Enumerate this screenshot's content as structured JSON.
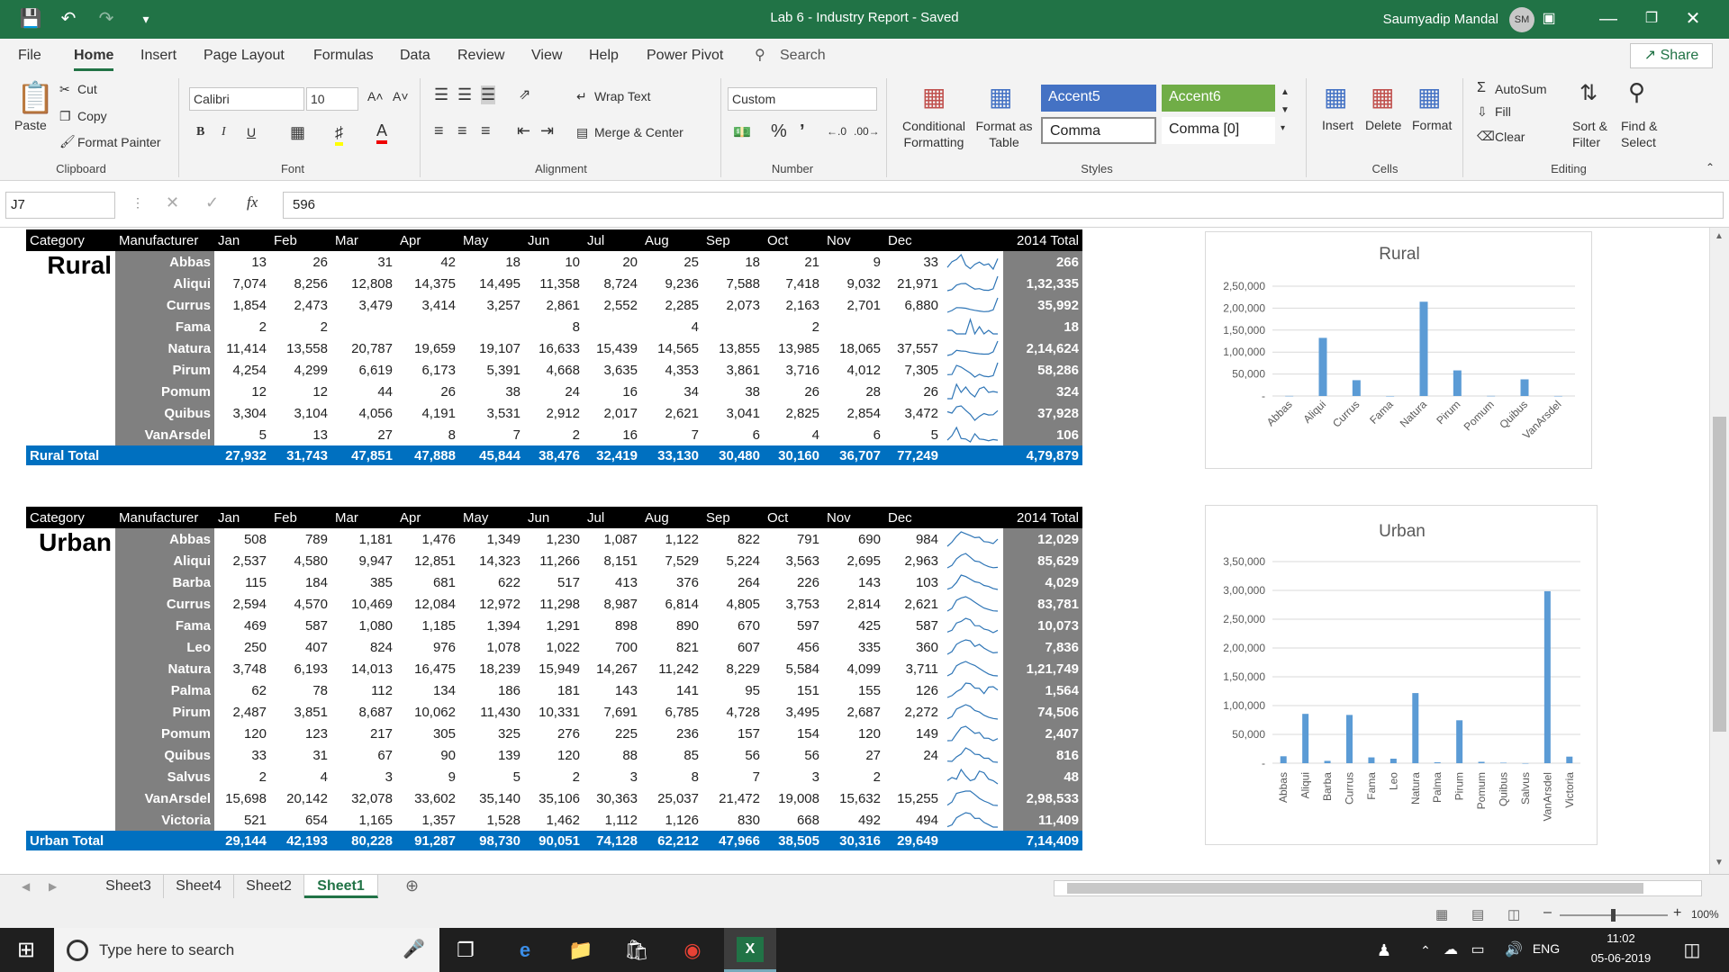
{
  "window": {
    "title": "Lab 6 - Industry Report  -  Saved",
    "user": "Saumyadip Mandal",
    "initials": "SM"
  },
  "menu": {
    "tabs": [
      "File",
      "Home",
      "Insert",
      "Page Layout",
      "Formulas",
      "Data",
      "Review",
      "View",
      "Help",
      "Power Pivot"
    ],
    "search": "Search",
    "share": "Share"
  },
  "ribbon": {
    "clipboard": {
      "paste": "Paste",
      "cut": "Cut",
      "copy": "Copy",
      "format_painter": "Format Painter",
      "label": "Clipboard"
    },
    "font": {
      "name": "Calibri",
      "size": "10",
      "label": "Font",
      "bold": "B",
      "italic": "I",
      "underline": "U"
    },
    "alignment": {
      "wrap": "Wrap Text",
      "merge": "Merge & Center",
      "label": "Alignment"
    },
    "number": {
      "format": "Custom",
      "label": "Number",
      "percent": "%"
    },
    "styles": {
      "conditional": "Conditional Formatting",
      "format_table": "Format as Table",
      "accent5": "Accent5",
      "accent6": "Accent6",
      "comma": "Comma",
      "comma0": "Comma [0]",
      "label": "Styles"
    },
    "cells": {
      "insert": "Insert",
      "delete": "Delete",
      "format": "Format",
      "label": "Cells"
    },
    "editing": {
      "autosum": "AutoSum",
      "fill": "Fill",
      "clear": "Clear",
      "sort": "Sort & Filter",
      "find": "Find & Select",
      "label": "Editing"
    }
  },
  "formula_bar": {
    "cell": "J7",
    "value": "596",
    "fx": "fx"
  },
  "headers": {
    "category": "Category",
    "manufacturer": "Manufacturer",
    "months": [
      "Jan",
      "Feb",
      "Mar",
      "Apr",
      "May",
      "Jun",
      "Jul",
      "Aug",
      "Sep",
      "Oct",
      "Nov",
      "Dec"
    ],
    "total": "2014 Total"
  },
  "rural": {
    "category": "Rural",
    "rows": [
      {
        "name": "Abbas",
        "m": [
          "13",
          "26",
          "31",
          "42",
          "18",
          "10",
          "20",
          "25",
          "18",
          "21",
          "9",
          "33"
        ],
        "total": "266",
        "spark": [
          13,
          26,
          31,
          42,
          18,
          10,
          20,
          25,
          18,
          21,
          9,
          33
        ]
      },
      {
        "name": "Aliqui",
        "m": [
          "7,074",
          "8,256",
          "12,808",
          "14,375",
          "14,495",
          "11,358",
          "8,724",
          "9,236",
          "7,588",
          "7,418",
          "9,032",
          "21,971"
        ],
        "total": "1,32,335",
        "spark": [
          7074,
          8256,
          12808,
          14375,
          14495,
          11358,
          8724,
          9236,
          7588,
          7418,
          9032,
          21971
        ]
      },
      {
        "name": "Currus",
        "m": [
          "1,854",
          "2,473",
          "3,479",
          "3,414",
          "3,257",
          "2,861",
          "2,552",
          "2,285",
          "2,073",
          "2,163",
          "2,701",
          "6,880"
        ],
        "total": "35,992",
        "spark": [
          1854,
          2473,
          3479,
          3414,
          3257,
          2861,
          2552,
          2285,
          2073,
          2163,
          2701,
          6880
        ]
      },
      {
        "name": "Fama",
        "m": [
          "2",
          "2",
          "",
          "",
          "",
          "8",
          "",
          "4",
          "",
          "2",
          "",
          ""
        ],
        "total": "18",
        "spark": [
          2,
          2,
          0,
          0,
          0,
          8,
          0,
          4,
          0,
          2,
          0,
          0
        ]
      },
      {
        "name": "Natura",
        "m": [
          "11,414",
          "13,558",
          "20,787",
          "19,659",
          "19,107",
          "16,633",
          "15,439",
          "14,565",
          "13,855",
          "13,985",
          "18,065",
          "37,557"
        ],
        "total": "2,14,624",
        "spark": [
          11414,
          13558,
          20787,
          19659,
          19107,
          16633,
          15439,
          14565,
          13855,
          13985,
          18065,
          37557
        ]
      },
      {
        "name": "Pirum",
        "m": [
          "4,254",
          "4,299",
          "6,619",
          "6,173",
          "5,391",
          "4,668",
          "3,635",
          "4,353",
          "3,861",
          "3,716",
          "4,012",
          "7,305"
        ],
        "total": "58,286",
        "spark": [
          4254,
          4299,
          6619,
          6173,
          5391,
          4668,
          3635,
          4353,
          3861,
          3716,
          4012,
          7305
        ]
      },
      {
        "name": "Pomum",
        "m": [
          "12",
          "12",
          "44",
          "26",
          "38",
          "24",
          "16",
          "34",
          "38",
          "26",
          "28",
          "26"
        ],
        "total": "324",
        "spark": [
          12,
          12,
          44,
          26,
          38,
          24,
          16,
          34,
          38,
          26,
          28,
          26
        ]
      },
      {
        "name": "Quibus",
        "m": [
          "3,304",
          "3,104",
          "4,056",
          "4,191",
          "3,531",
          "2,912",
          "2,017",
          "2,621",
          "3,041",
          "2,825",
          "2,854",
          "3,472"
        ],
        "total": "37,928",
        "spark": [
          3304,
          3104,
          4056,
          4191,
          3531,
          2912,
          2017,
          2621,
          3041,
          2825,
          2854,
          3472
        ]
      },
      {
        "name": "VanArsdel",
        "m": [
          "5",
          "13",
          "27",
          "8",
          "7",
          "2",
          "16",
          "7",
          "6",
          "4",
          "6",
          "5"
        ],
        "total": "106",
        "spark": [
          5,
          13,
          27,
          8,
          7,
          2,
          16,
          7,
          6,
          4,
          6,
          5
        ]
      }
    ],
    "total_row": {
      "label": "Rural Total",
      "m": [
        "27,932",
        "31,743",
        "47,851",
        "47,888",
        "45,844",
        "38,476",
        "32,419",
        "33,130",
        "30,480",
        "30,160",
        "36,707",
        "77,249"
      ],
      "total": "4,79,879"
    }
  },
  "urban": {
    "category": "Urban",
    "rows": [
      {
        "name": "Abbas",
        "m": [
          "508",
          "789",
          "1,181",
          "1,476",
          "1,349",
          "1,230",
          "1,087",
          "1,122",
          "822",
          "791",
          "690",
          "984"
        ],
        "total": "12,029",
        "spark": [
          508,
          789,
          1181,
          1476,
          1349,
          1230,
          1087,
          1122,
          822,
          791,
          690,
          984
        ]
      },
      {
        "name": "Aliqui",
        "m": [
          "2,537",
          "4,580",
          "9,947",
          "12,851",
          "14,323",
          "11,266",
          "8,151",
          "7,529",
          "5,224",
          "3,563",
          "2,695",
          "2,963"
        ],
        "total": "85,629",
        "spark": [
          2537,
          4580,
          9947,
          12851,
          14323,
          11266,
          8151,
          7529,
          5224,
          3563,
          2695,
          2963
        ]
      },
      {
        "name": "Barba",
        "m": [
          "115",
          "184",
          "385",
          "681",
          "622",
          "517",
          "413",
          "376",
          "264",
          "226",
          "143",
          "103"
        ],
        "total": "4,029",
        "spark": [
          115,
          184,
          385,
          681,
          622,
          517,
          413,
          376,
          264,
          226,
          143,
          103
        ]
      },
      {
        "name": "Currus",
        "m": [
          "2,594",
          "4,570",
          "10,469",
          "12,084",
          "12,972",
          "11,298",
          "8,987",
          "6,814",
          "4,805",
          "3,753",
          "2,814",
          "2,621"
        ],
        "total": "83,781",
        "spark": [
          2594,
          4570,
          10469,
          12084,
          12972,
          11298,
          8987,
          6814,
          4805,
          3753,
          2814,
          2621
        ]
      },
      {
        "name": "Fama",
        "m": [
          "469",
          "587",
          "1,080",
          "1,185",
          "1,394",
          "1,291",
          "898",
          "890",
          "670",
          "597",
          "425",
          "587"
        ],
        "total": "10,073",
        "spark": [
          469,
          587,
          1080,
          1185,
          1394,
          1291,
          898,
          890,
          670,
          597,
          425,
          587
        ]
      },
      {
        "name": "Leo",
        "m": [
          "250",
          "407",
          "824",
          "976",
          "1,078",
          "1,022",
          "700",
          "821",
          "607",
          "456",
          "335",
          "360"
        ],
        "total": "7,836",
        "spark": [
          250,
          407,
          824,
          976,
          1078,
          1022,
          700,
          821,
          607,
          456,
          335,
          360
        ]
      },
      {
        "name": "Natura",
        "m": [
          "3,748",
          "6,193",
          "14,013",
          "16,475",
          "18,239",
          "15,949",
          "14,267",
          "11,242",
          "8,229",
          "5,584",
          "4,099",
          "3,711"
        ],
        "total": "1,21,749",
        "spark": [
          3748,
          6193,
          14013,
          16475,
          18239,
          15949,
          14267,
          11242,
          8229,
          5584,
          4099,
          3711
        ]
      },
      {
        "name": "Palma",
        "m": [
          "62",
          "78",
          "112",
          "134",
          "186",
          "181",
          "143",
          "141",
          "95",
          "151",
          "155",
          "126"
        ],
        "total": "1,564",
        "spark": [
          62,
          78,
          112,
          134,
          186,
          181,
          143,
          141,
          95,
          151,
          155,
          126
        ]
      },
      {
        "name": "Pirum",
        "m": [
          "2,487",
          "3,851",
          "8,687",
          "10,062",
          "11,430",
          "10,331",
          "7,691",
          "6,785",
          "4,728",
          "3,495",
          "2,687",
          "2,272"
        ],
        "total": "74,506",
        "spark": [
          2487,
          3851,
          8687,
          10062,
          11430,
          10331,
          7691,
          6785,
          4728,
          3495,
          2687,
          2272
        ]
      },
      {
        "name": "Pomum",
        "m": [
          "120",
          "123",
          "217",
          "305",
          "325",
          "276",
          "225",
          "236",
          "157",
          "154",
          "120",
          "149"
        ],
        "total": "2,407",
        "spark": [
          120,
          123,
          217,
          305,
          325,
          276,
          225,
          236,
          157,
          154,
          120,
          149
        ]
      },
      {
        "name": "Quibus",
        "m": [
          "33",
          "31",
          "67",
          "90",
          "139",
          "120",
          "88",
          "85",
          "56",
          "56",
          "27",
          "24"
        ],
        "total": "816",
        "spark": [
          33,
          31,
          67,
          90,
          139,
          120,
          88,
          85,
          56,
          56,
          27,
          24
        ]
      },
      {
        "name": "Salvus",
        "m": [
          "2",
          "4",
          "3",
          "9",
          "5",
          "2",
          "3",
          "8",
          "7",
          "3",
          "2",
          ""
        ],
        "total": "48",
        "spark": [
          2,
          4,
          3,
          9,
          5,
          2,
          3,
          8,
          7,
          3,
          2,
          0
        ]
      },
      {
        "name": "VanArsdel",
        "m": [
          "15,698",
          "20,142",
          "32,078",
          "33,602",
          "35,140",
          "35,106",
          "30,363",
          "25,037",
          "21,472",
          "19,008",
          "15,632",
          "15,255"
        ],
        "total": "2,98,533",
        "spark": [
          15698,
          20142,
          32078,
          33602,
          35140,
          35106,
          30363,
          25037,
          21472,
          19008,
          15632,
          15255
        ]
      },
      {
        "name": "Victoria",
        "m": [
          "521",
          "654",
          "1,165",
          "1,357",
          "1,528",
          "1,462",
          "1,112",
          "1,126",
          "830",
          "668",
          "492",
          "494"
        ],
        "total": "11,409",
        "spark": [
          521,
          654,
          1165,
          1357,
          1528,
          1462,
          1112,
          1126,
          830,
          668,
          492,
          494
        ]
      }
    ],
    "total_row": {
      "label": "Urban Total",
      "m": [
        "29,144",
        "42,193",
        "80,228",
        "91,287",
        "98,730",
        "90,051",
        "74,128",
        "62,212",
        "47,966",
        "38,505",
        "30,316",
        "29,649"
      ],
      "total": "7,14,409"
    }
  },
  "chart_data": [
    {
      "type": "bar",
      "title": "Rural",
      "categories": [
        "Abbas",
        "Aliqui",
        "Currus",
        "Fama",
        "Natura",
        "Pirum",
        "Pomum",
        "Quibus",
        "VanArsdel"
      ],
      "values": [
        266,
        132335,
        35992,
        18,
        214624,
        58286,
        324,
        37928,
        106
      ],
      "ylim": [
        0,
        250000
      ],
      "yticks": [
        "-",
        "50,000",
        "1,00,000",
        "1,50,000",
        "2,00,000",
        "2,50,000"
      ],
      "color": "#5b9bd5",
      "grid": true
    },
    {
      "type": "bar",
      "title": "Urban",
      "categories": [
        "Abbas",
        "Aliqui",
        "Barba",
        "Currus",
        "Fama",
        "Leo",
        "Natura",
        "Palma",
        "Pirum",
        "Pomum",
        "Quibus",
        "Salvus",
        "VanArsdel",
        "Victoria"
      ],
      "values": [
        12029,
        85629,
        4029,
        83781,
        10073,
        7836,
        121749,
        1564,
        74506,
        2407,
        816,
        48,
        298533,
        11409
      ],
      "ylim": [
        0,
        350000
      ],
      "yticks": [
        "-",
        "50,000",
        "1,00,000",
        "1,50,000",
        "2,00,000",
        "2,50,000",
        "3,00,000",
        "3,50,000"
      ],
      "color": "#5b9bd5",
      "grid": true
    }
  ],
  "sheets": {
    "tabs": [
      "Sheet3",
      "Sheet4",
      "Sheet2",
      "Sheet1"
    ],
    "active": "Sheet1"
  },
  "status": {
    "zoom": "100%"
  },
  "taskbar": {
    "search": "Type here to search",
    "lang": "ENG",
    "time": "11:02",
    "date": "05-06-2019"
  },
  "colors": {
    "excel_green": "#217346",
    "header": "#000000",
    "manufacturer_bg": "#808080",
    "total_bg": "#0070c0",
    "bar": "#5b9bd5"
  }
}
